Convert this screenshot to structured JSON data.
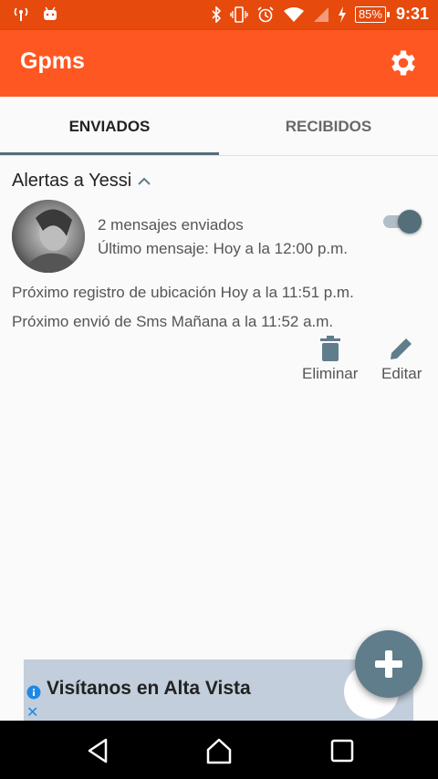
{
  "status_bar": {
    "battery": "85%",
    "time": "9:31"
  },
  "app": {
    "title": "Gpms"
  },
  "tabs": [
    {
      "label": "ENVIADOS"
    },
    {
      "label": "RECIBIDOS"
    }
  ],
  "alert": {
    "title": "Alertas a Yessi",
    "messages_sent": "2 mensajes enviados",
    "last_message": "Último mensaje: Hoy a la 12:00 p.m.",
    "next_location": "Próximo registro de ubicación Hoy a la 11:51 p.m.",
    "next_sms": "Próximo envió de Sms Mañana a la 11:52 a.m.",
    "enabled": true,
    "actions": {
      "delete_label": "Eliminar",
      "edit_label": "Editar"
    }
  },
  "ad": {
    "text": "Visítanos en Alta Vista",
    "close": "✕"
  },
  "colors": {
    "appbar": "#ff5722",
    "statusbar": "#e64a0d",
    "accent": "#546e7a",
    "fab": "#607d8b"
  },
  "icons": [
    "signal-icon",
    "android-icon",
    "bluetooth-icon",
    "vibrate-icon",
    "alarm-icon",
    "wifi-icon",
    "cell-signal-icon",
    "charging-icon",
    "settings-icon",
    "chevron-up-icon",
    "trash-icon",
    "pencil-icon",
    "add-icon",
    "back-icon",
    "home-icon",
    "recents-icon",
    "info-icon"
  ]
}
